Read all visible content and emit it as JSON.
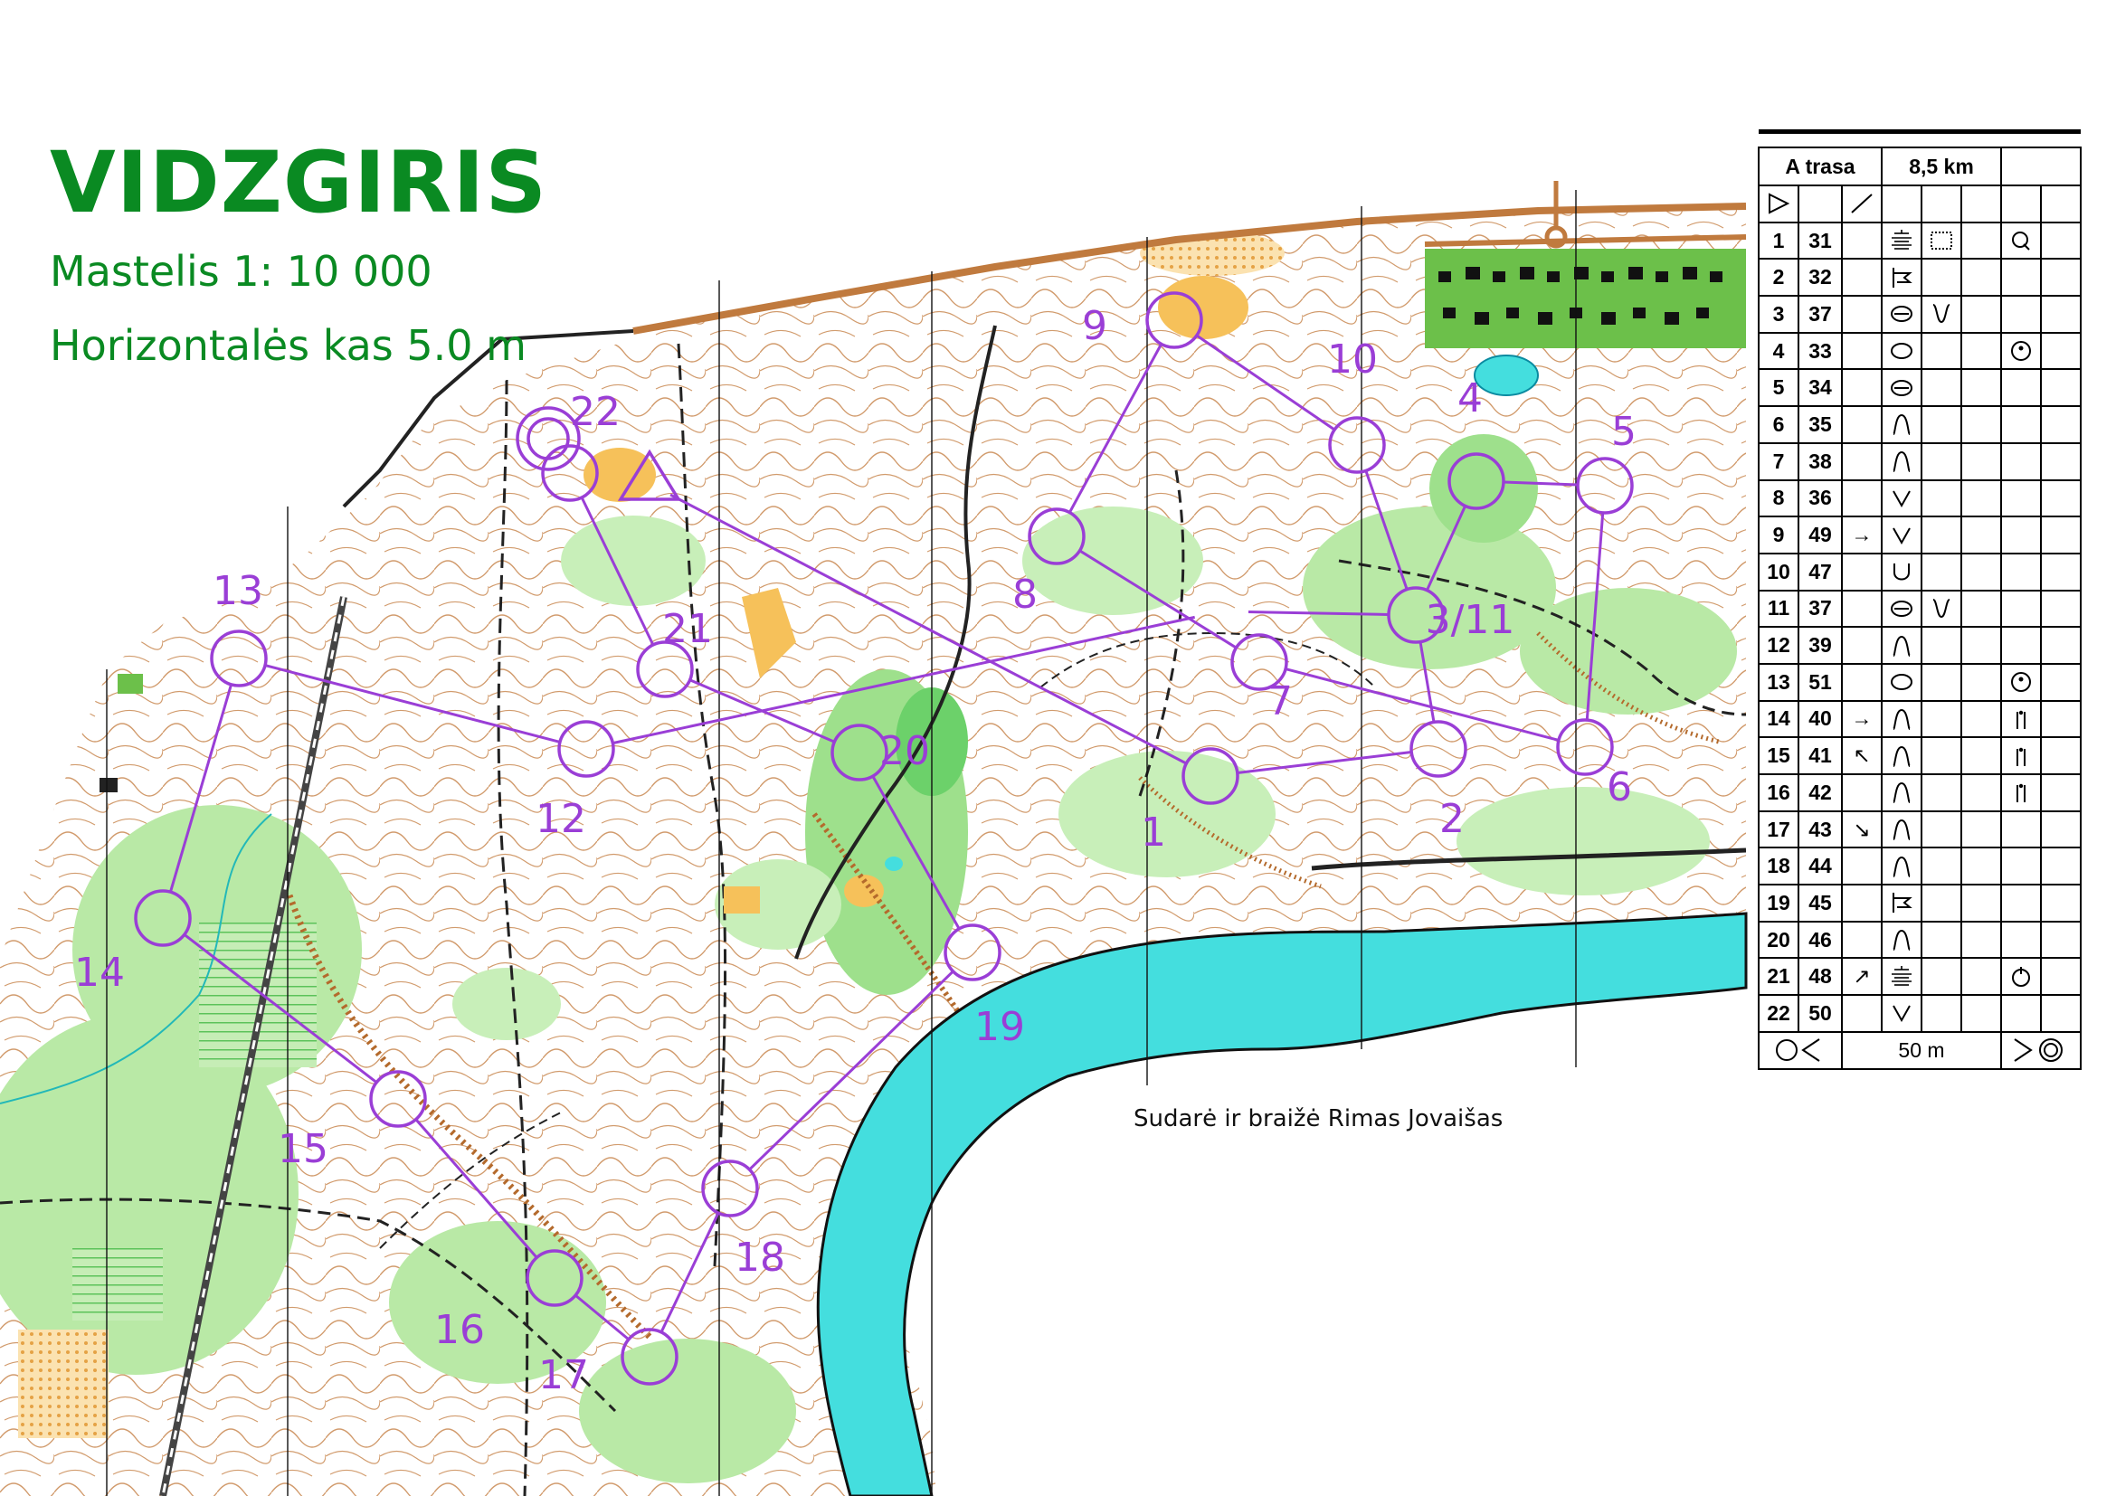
{
  "map": {
    "title": "VIDZGIRIS",
    "scale": "Mastelis 1: 10 000",
    "contour": "Horizontalės kas 5.0 m",
    "credit": "Sudarė ir braižė Rimas Jovaišas"
  },
  "colors": {
    "title_green": "#0a8a22",
    "course_purple": "#9a3ed6",
    "water": "#44dede",
    "forest_green": "#b9e9a6",
    "dark_green": "#6cd16a",
    "open_yellow": "#f6c15a",
    "contour_brown": "#b46a2c",
    "road_brown": "#c07a3e"
  },
  "controls": [
    {
      "label": "1"
    },
    {
      "label": "2"
    },
    {
      "label": "3/11"
    },
    {
      "label": "4"
    },
    {
      "label": "5"
    },
    {
      "label": "6"
    },
    {
      "label": "7"
    },
    {
      "label": "8"
    },
    {
      "label": "9"
    },
    {
      "label": "10"
    },
    {
      "label": "12"
    },
    {
      "label": "13"
    },
    {
      "label": "14"
    },
    {
      "label": "15"
    },
    {
      "label": "16"
    },
    {
      "label": "17"
    },
    {
      "label": "18"
    },
    {
      "label": "19"
    },
    {
      "label": "20"
    },
    {
      "label": "21"
    },
    {
      "label": "22"
    }
  ],
  "description_sheet": {
    "course": "A trasa",
    "length": "8,5 km",
    "rows": [
      {
        "num": "1",
        "code": "31",
        "dir": "",
        "feature": "crag-lines-icon",
        "extra": "marsh-box-icon",
        "where": "detail-q-icon"
      },
      {
        "num": "2",
        "code": "32",
        "dir": "",
        "feature": "junction-icon",
        "extra": "",
        "where": ""
      },
      {
        "num": "3",
        "code": "37",
        "dir": "",
        "feature": "saddle-knoll-icon",
        "extra": "gully-u-icon",
        "where": ""
      },
      {
        "num": "4",
        "code": "33",
        "dir": "",
        "feature": "knoll-icon",
        "extra": "",
        "where": "dot-circle-icon"
      },
      {
        "num": "5",
        "code": "34",
        "dir": "",
        "feature": "saddle-knoll-icon",
        "extra": "",
        "where": ""
      },
      {
        "num": "6",
        "code": "35",
        "dir": "",
        "feature": "spur-icon",
        "extra": "",
        "where": ""
      },
      {
        "num": "7",
        "code": "38",
        "dir": "",
        "feature": "spur-icon",
        "extra": "",
        "where": ""
      },
      {
        "num": "8",
        "code": "36",
        "dir": "",
        "feature": "reentrant-v-icon",
        "extra": "",
        "where": ""
      },
      {
        "num": "9",
        "code": "49",
        "dir": "→",
        "feature": "reentrant-v-icon",
        "extra": "",
        "where": ""
      },
      {
        "num": "10",
        "code": "47",
        "dir": "",
        "feature": "depression-u-icon",
        "extra": "",
        "where": ""
      },
      {
        "num": "11",
        "code": "37",
        "dir": "",
        "feature": "saddle-knoll-icon",
        "extra": "gully-u-icon",
        "where": ""
      },
      {
        "num": "12",
        "code": "39",
        "dir": "",
        "feature": "spur-icon",
        "extra": "",
        "where": ""
      },
      {
        "num": "13",
        "code": "51",
        "dir": "",
        "feature": "knoll-icon",
        "extra": "",
        "where": "dot-circle-icon"
      },
      {
        "num": "14",
        "code": "40",
        "dir": "→",
        "feature": "spur-icon",
        "extra": "",
        "where": "foot-icon"
      },
      {
        "num": "15",
        "code": "41",
        "dir": "↖",
        "feature": "spur-icon",
        "extra": "",
        "where": "foot-icon"
      },
      {
        "num": "16",
        "code": "42",
        "dir": "",
        "feature": "spur-icon",
        "extra": "",
        "where": "foot-icon"
      },
      {
        "num": "17",
        "code": "43",
        "dir": "↘",
        "feature": "spur-icon",
        "extra": "",
        "where": ""
      },
      {
        "num": "18",
        "code": "44",
        "dir": "",
        "feature": "spur-icon",
        "extra": "",
        "where": ""
      },
      {
        "num": "19",
        "code": "45",
        "dir": "",
        "feature": "junction-icon",
        "extra": "",
        "where": ""
      },
      {
        "num": "20",
        "code": "46",
        "dir": "",
        "feature": "spur-icon",
        "extra": "",
        "where": ""
      },
      {
        "num": "21",
        "code": "48",
        "dir": "↗",
        "feature": "crag-lines-icon",
        "extra": "",
        "where": "top-circle-icon"
      },
      {
        "num": "22",
        "code": "50",
        "dir": "",
        "feature": "reentrant-v-icon",
        "extra": "",
        "where": ""
      }
    ],
    "finish_distance": "50 m"
  }
}
